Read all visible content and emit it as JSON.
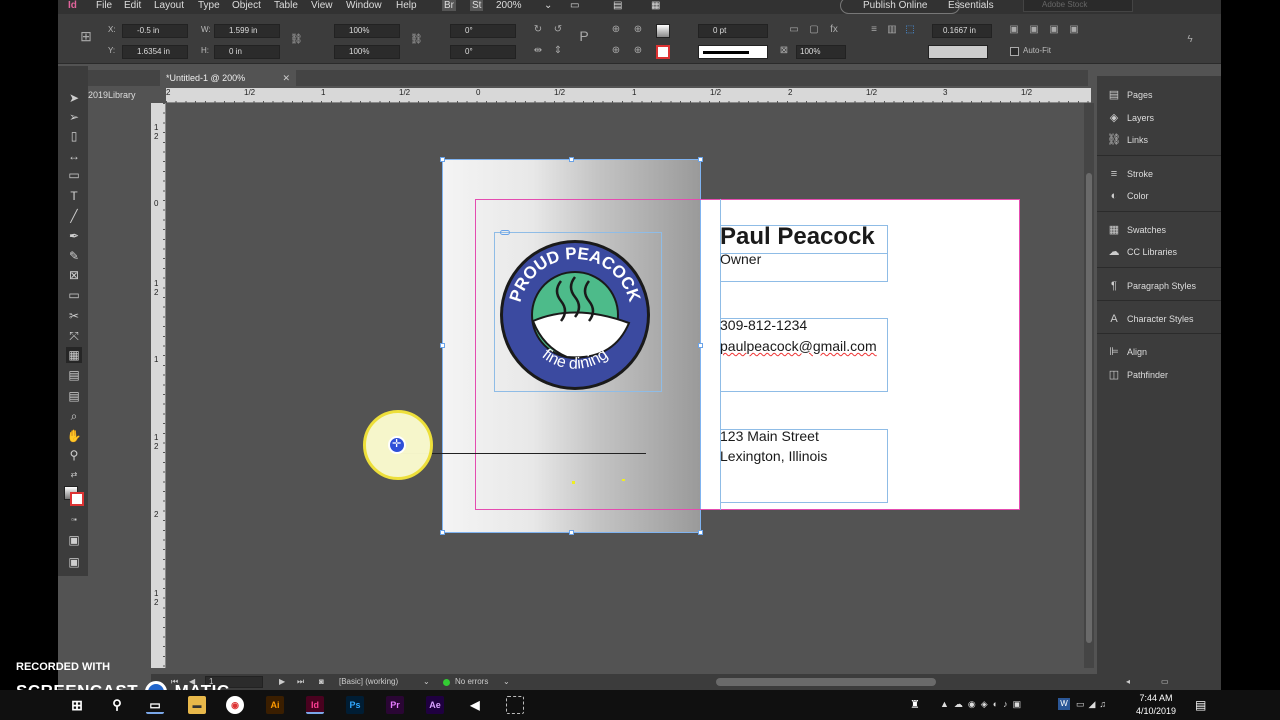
{
  "menu": [
    "File",
    "Edit",
    "Layout",
    "Type",
    "Object",
    "Table",
    "View",
    "Window",
    "Help"
  ],
  "menu_badges": [
    "Br",
    "St"
  ],
  "zoom": "200%",
  "publish_online": "Publish Online",
  "workspace": "Essentials",
  "search_placeholder": "Adobe Stock",
  "control": {
    "x_label": "X:",
    "x_value": "-0.5 in",
    "y_label": "Y:",
    "y_value": "1.6354 in",
    "w_label": "W:",
    "w_value": "1.599 in",
    "h_label": "H:",
    "h_value": "0 in",
    "scale_x": "100%",
    "scale_y": "100%",
    "angle": "0°",
    "shear": "0°",
    "stroke_weight": "0 pt",
    "opacity": "100%",
    "offset": "0.1667 in",
    "auto_fit": "Auto-Fit"
  },
  "doc_tab": "*Untitled-1 @ 200%",
  "library_tab": "2019Library",
  "ruler_h": [
    "2",
    "1/2",
    "1",
    "1/2",
    "0",
    "1/2",
    "1",
    "1/2",
    "2",
    "1/2",
    "3",
    "1/2"
  ],
  "ruler_v": [
    "1",
    "2",
    "0",
    "1",
    "2",
    "1",
    "1",
    "2",
    "2",
    "1",
    "2"
  ],
  "panels": [
    "Pages",
    "Layers",
    "Links",
    "Stroke",
    "Color",
    "Swatches",
    "CC Libraries",
    "Paragraph Styles",
    "Character Styles",
    "Align",
    "Pathfinder"
  ],
  "card": {
    "name": "Paul Peacock",
    "title": "Owner",
    "phone": "309-812-1234",
    "email": "paulpeacock@gmail.com",
    "street": "123 Main Street",
    "city": "Lexington, Illinois"
  },
  "logo": {
    "top_text": "PROUD PEACOCK",
    "bottom_text": "fine dining",
    "ring_color": "#3b4aa0",
    "center_color": "#4dbb8a"
  },
  "status": {
    "page": "1",
    "profile": "[Basic] (working)",
    "errors": "No errors"
  },
  "watermark": {
    "recorded_with": "RECORDED WITH",
    "brand_left": "SCREENCAST",
    "brand_right": "MATIC"
  },
  "clock": {
    "time": "7:44 AM",
    "date": "4/10/2019"
  }
}
